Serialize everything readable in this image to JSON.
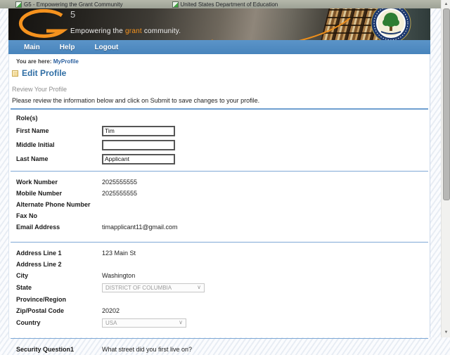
{
  "window": {
    "tab1_title": "G5 - Empowering the Grant Community",
    "tab2_title": "United States Department of Education"
  },
  "banner": {
    "logo_number": "5",
    "tagline_prefix": "Empowering the ",
    "tagline_highlight": "grant",
    "tagline_suffix": " community."
  },
  "nav": {
    "items": [
      {
        "label": "Main"
      },
      {
        "label": "Help"
      },
      {
        "label": "Logout"
      }
    ]
  },
  "breadcrumb": {
    "prefix": "You are here: ",
    "current": "MyProfile"
  },
  "page": {
    "title": "Edit Profile",
    "section_heading": "Review Your Profile",
    "instructions": "Please review the information below and click on Submit to save changes to your profile."
  },
  "form": {
    "groups": [
      {
        "rows": [
          {
            "label": "Role(s)",
            "type": "static",
            "value": ""
          },
          {
            "label": "First Name",
            "type": "input",
            "value": "Tim"
          },
          {
            "label": "Middle Initial",
            "type": "input",
            "value": ""
          },
          {
            "label": "Last Name",
            "type": "input",
            "value": "Applicant"
          }
        ]
      },
      {
        "rows": [
          {
            "label": "Work Number",
            "type": "static",
            "value": "2025555555"
          },
          {
            "label": "Mobile Number",
            "type": "static",
            "value": "2025555555"
          },
          {
            "label": "Alternate Phone Number",
            "type": "static",
            "value": ""
          },
          {
            "label": "Fax No",
            "type": "static",
            "value": ""
          },
          {
            "label": "Email Address",
            "type": "static",
            "value": "timapplicant11@gmail.com"
          }
        ]
      },
      {
        "rows": [
          {
            "label": "Address Line 1",
            "type": "static",
            "value": "123 Main St"
          },
          {
            "label": "Address Line 2",
            "type": "static",
            "value": ""
          },
          {
            "label": "City",
            "type": "static",
            "value": "Washington"
          },
          {
            "label": "State",
            "type": "select",
            "value": "DISTRICT OF COLUMBIA"
          },
          {
            "label": "Province/Region",
            "type": "static",
            "value": ""
          },
          {
            "label": "Zip/Postal Code",
            "type": "static",
            "value": "20202"
          },
          {
            "label": "Country",
            "type": "select",
            "value": "USA"
          }
        ]
      },
      {
        "rows": [
          {
            "label": "Security Question1",
            "type": "static",
            "value": "What street did you first live on?"
          }
        ]
      }
    ]
  },
  "icons": {
    "chevron_down": "∨",
    "scroll_up": "▲",
    "scroll_down": "▼"
  },
  "colors": {
    "nav_blue": "#4E8ABE",
    "accent_orange": "#F7941E",
    "heading_blue": "#2E6DA4",
    "divider_blue": "#7FA9D6",
    "link_blue": "#2A5F9E"
  }
}
